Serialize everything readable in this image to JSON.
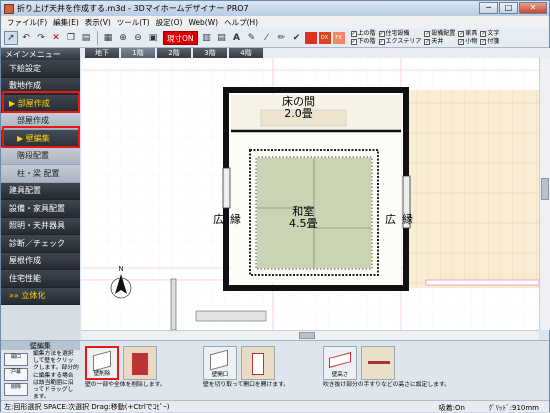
{
  "window": {
    "title": "折り上げ天井を作成する.m3d - 3Dマイホームデザイナー PRO7",
    "minimize": "─",
    "maximize": "□",
    "close": "✕"
  },
  "menu": [
    "ファイル(F)",
    "編集(E)",
    "表示(V)",
    "ツール(T)",
    "設定(O)",
    "Web(W)",
    "ヘルプ(H)"
  ],
  "toolbar": {
    "genzu_label": "現寸ON",
    "checkboxes": [
      "上の階",
      "下の階",
      "住宅設備",
      "エクステリア",
      "設備配置",
      "天井",
      "家具",
      "小物",
      "文字",
      "付箋"
    ],
    "colors": {
      "accent": "#d00000"
    }
  },
  "sidebar": {
    "header": "メインメニュー",
    "items": [
      {
        "label": "下絵設定",
        "kind": "item"
      },
      {
        "label": "敷地作成",
        "kind": "item"
      },
      {
        "label": "▶ 部屋作成",
        "kind": "item",
        "active": true
      },
      {
        "label": "部屋作成",
        "kind": "sub"
      },
      {
        "label": "▶ 壁編集",
        "kind": "sub",
        "active": true
      },
      {
        "label": "階段配置",
        "kind": "sub"
      },
      {
        "label": "柱・梁 配置",
        "kind": "sub"
      },
      {
        "label": "建具配置",
        "kind": "item"
      },
      {
        "label": "設備・家具配置",
        "kind": "item"
      },
      {
        "label": "照明・天井器具",
        "kind": "item"
      },
      {
        "label": "診断／チェック",
        "kind": "item"
      },
      {
        "label": "屋根作成",
        "kind": "item"
      },
      {
        "label": "住宅性能",
        "kind": "item"
      },
      {
        "label": "»» 立体化",
        "kind": "item"
      }
    ]
  },
  "floor_tabs": [
    "地下",
    "1階",
    "2階",
    "3階",
    "4階"
  ],
  "active_floor": "1階",
  "plan": {
    "rooms": [
      {
        "name": "床の間",
        "size": "2.0畳"
      },
      {
        "name": "和室",
        "size": "4.5畳"
      },
      {
        "name": "広縁",
        "size": ""
      },
      {
        "name": "広縁",
        "size": ""
      }
    ],
    "north": "N"
  },
  "bottom_panel": {
    "title": "壁編集",
    "side_icons": [
      "開口",
      "戸幕",
      "削除"
    ],
    "description": "編集方法を選択して壁をクリックします。部分的に編集する場合は該当範囲に沿ってドラッグします。",
    "tools": [
      {
        "label": "壁削除",
        "caption": "壁の一部や全体を削除します。"
      },
      {
        "label": "壁開口",
        "caption": "壁を切り取って開口を開けます。"
      },
      {
        "label": "壁高さ",
        "caption": "吹き抜け部分の手すりなどの高さに設定します。"
      }
    ]
  },
  "status": {
    "left": "左:回形選択 SPACE:次選択 Drag:移動(+Ctrlでｺﾋﾟｰ)",
    "snap": "吸着:On",
    "grid": "ｸﾞﾘｯﾄﾞ:910mm"
  }
}
